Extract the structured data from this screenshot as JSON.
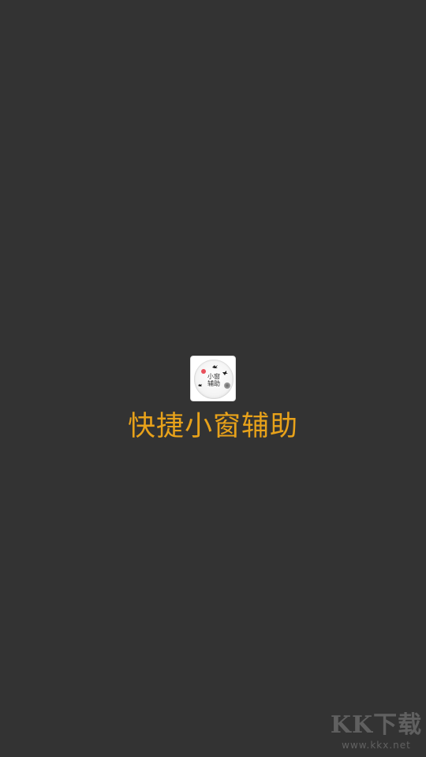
{
  "splash": {
    "app_name": "快捷小窗辅助",
    "icon_label_line1": "小窗",
    "icon_label_line2": "辅助",
    "accent_color": "#E8A21A",
    "background_color": "#333333"
  },
  "watermark": {
    "logo_text": "KK下载",
    "url": "www.kkx.net"
  }
}
